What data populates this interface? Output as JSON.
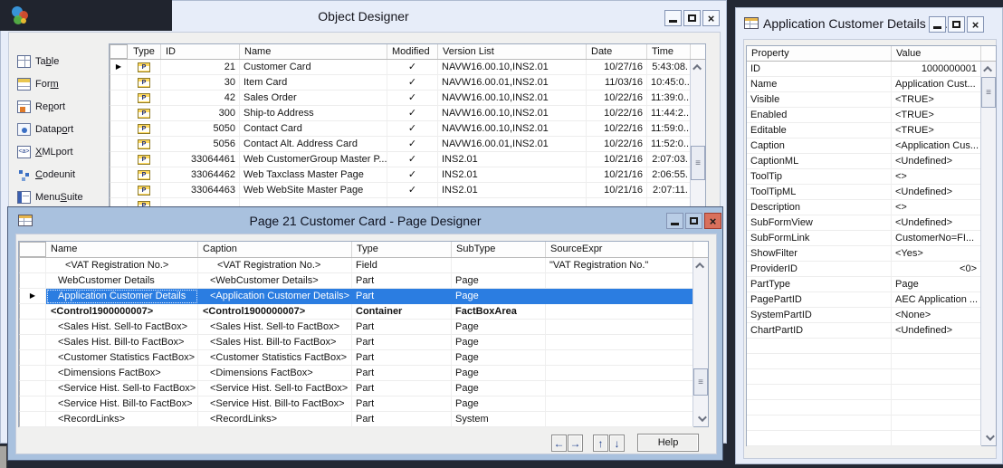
{
  "object_designer": {
    "title": "Object Designer",
    "sidebar": [
      {
        "pre": "Ta",
        "key": "b",
        "post": "le",
        "icon": "table"
      },
      {
        "pre": "For",
        "key": "m",
        "post": "",
        "icon": "form"
      },
      {
        "pre": "Re",
        "key": "p",
        "post": "ort",
        "icon": "report"
      },
      {
        "pre": "Datap",
        "key": "o",
        "post": "rt",
        "icon": "dataport"
      },
      {
        "pre": "",
        "key": "X",
        "post": "MLport",
        "icon": "xmlport"
      },
      {
        "pre": "",
        "key": "C",
        "post": "odeunit",
        "icon": "codeunit"
      },
      {
        "pre": "Menu",
        "key": "S",
        "post": "uite",
        "icon": "menusuite"
      }
    ],
    "columns": {
      "type": "Type",
      "id": "ID",
      "name": "Name",
      "modified": "Modified",
      "version": "Version List",
      "date": "Date",
      "time": "Time"
    },
    "rows": [
      {
        "sel": "▶",
        "id": "21",
        "name": "Customer Card",
        "mod": "✓",
        "version": "NAVW16.00.10,INS2.01",
        "date": "10/27/16",
        "time": "5:43:08."
      },
      {
        "sel": "",
        "id": "30",
        "name": "Item Card",
        "mod": "✓",
        "version": "NAVW16.00.01,INS2.01",
        "date": "11/03/16",
        "time": "10:45:0.."
      },
      {
        "sel": "",
        "id": "42",
        "name": "Sales Order",
        "mod": "✓",
        "version": "NAVW16.00.10,INS2.01",
        "date": "10/22/16",
        "time": "11:39:0.."
      },
      {
        "sel": "",
        "id": "300",
        "name": "Ship-to Address",
        "mod": "✓",
        "version": "NAVW16.00.10,INS2.01",
        "date": "10/22/16",
        "time": "11:44:2.."
      },
      {
        "sel": "",
        "id": "5050",
        "name": "Contact Card",
        "mod": "✓",
        "version": "NAVW16.00.10,INS2.01",
        "date": "10/22/16",
        "time": "11:59:0.."
      },
      {
        "sel": "",
        "id": "5056",
        "name": "Contact Alt. Address Card",
        "mod": "✓",
        "version": "NAVW16.00.01,INS2.01",
        "date": "10/22/16",
        "time": "11:52:0.."
      },
      {
        "sel": "",
        "id": "33064461",
        "name": "Web CustomerGroup Master P...",
        "mod": "✓",
        "version": "INS2.01",
        "date": "10/21/16",
        "time": "2:07:03."
      },
      {
        "sel": "",
        "id": "33064462",
        "name": "Web Taxclass Master Page",
        "mod": "✓",
        "version": "INS2.01",
        "date": "10/21/16",
        "time": "2:06:55."
      },
      {
        "sel": "",
        "id": "33064463",
        "name": "Web WebSite Master Page",
        "mod": "✓",
        "version": "INS2.01",
        "date": "10/21/16",
        "time": "2:07:11."
      },
      {
        "sel": "",
        "id": "",
        "name": "",
        "mod": "",
        "version": "",
        "date": "",
        "time": ""
      }
    ]
  },
  "page_designer": {
    "title": "Page 21 Customer Card - Page Designer",
    "columns": {
      "name": "Name",
      "caption": "Caption",
      "type": "Type",
      "subtype": "SubType",
      "source": "SourceExpr"
    },
    "rows": [
      {
        "sel": "",
        "name": "<VAT Registration No.>",
        "caption": "<VAT Registration No.>",
        "type": "Field",
        "subtype": "",
        "source": "\"VAT Registration No.\"",
        "cls": "ind2"
      },
      {
        "sel": "",
        "name": "WebCustomer Details",
        "caption": "<WebCustomer Details>",
        "type": "Part",
        "subtype": "Page",
        "source": "",
        "cls": "ind1"
      },
      {
        "sel": "▶",
        "name": "Application Customer Details",
        "caption": "<Application Customer Details>",
        "type": "Part",
        "subtype": "Page",
        "source": "",
        "cls": "ind1 sel"
      },
      {
        "sel": "",
        "name": "<Control1900000007>",
        "caption": "<Control1900000007>",
        "type": "Container",
        "subtype": "FactBoxArea",
        "source": "",
        "cls": "ind0 bold"
      },
      {
        "sel": "",
        "name": "<Sales Hist. Sell-to FactBox>",
        "caption": "<Sales Hist. Sell-to FactBox>",
        "type": "Part",
        "subtype": "Page",
        "source": "",
        "cls": "ind1"
      },
      {
        "sel": "",
        "name": "<Sales Hist. Bill-to FactBox>",
        "caption": "<Sales Hist. Bill-to FactBox>",
        "type": "Part",
        "subtype": "Page",
        "source": "",
        "cls": "ind1"
      },
      {
        "sel": "",
        "name": "<Customer Statistics FactBox>",
        "caption": "<Customer Statistics FactBox>",
        "type": "Part",
        "subtype": "Page",
        "source": "",
        "cls": "ind1"
      },
      {
        "sel": "",
        "name": "<Dimensions FactBox>",
        "caption": "<Dimensions FactBox>",
        "type": "Part",
        "subtype": "Page",
        "source": "",
        "cls": "ind1"
      },
      {
        "sel": "",
        "name": "<Service Hist. Sell-to FactBox>",
        "caption": "<Service Hist. Sell-to FactBox>",
        "type": "Part",
        "subtype": "Page",
        "source": "",
        "cls": "ind1"
      },
      {
        "sel": "",
        "name": "<Service Hist. Bill-to FactBox>",
        "caption": "<Service Hist. Bill-to FactBox>",
        "type": "Part",
        "subtype": "Page",
        "source": "",
        "cls": "ind1"
      },
      {
        "sel": "",
        "name": "<RecordLinks>",
        "caption": "<RecordLinks>",
        "type": "Part",
        "subtype": "System",
        "source": "",
        "cls": "ind1"
      }
    ],
    "footer": {
      "left": "←",
      "right": "→",
      "up": "↑",
      "down": "↓",
      "help": "Help"
    }
  },
  "properties_window": {
    "title": "Application Customer Details - ...",
    "columns": {
      "property": "Property",
      "value": "Value"
    },
    "rows": [
      {
        "property": "ID",
        "value": "1000000001",
        "cls": "num"
      },
      {
        "property": "Name",
        "value": "Application Cust..."
      },
      {
        "property": "Visible",
        "value": "<TRUE>"
      },
      {
        "property": "Enabled",
        "value": "<TRUE>"
      },
      {
        "property": "Editable",
        "value": "<TRUE>"
      },
      {
        "property": "Caption",
        "value": "<Application Cus..."
      },
      {
        "property": "CaptionML",
        "value": "<Undefined>"
      },
      {
        "property": "ToolTip",
        "value": "<>"
      },
      {
        "property": "ToolTipML",
        "value": "<Undefined>"
      },
      {
        "property": "Description",
        "value": "<>"
      },
      {
        "property": "SubFormView",
        "value": "<Undefined>"
      },
      {
        "property": "SubFormLink",
        "value": "CustomerNo=FI..."
      },
      {
        "property": "ShowFilter",
        "value": "<Yes>"
      },
      {
        "property": "ProviderID",
        "value": "<0>",
        "cls": "num"
      },
      {
        "property": "PartType",
        "value": "Page"
      },
      {
        "property": "PagePartID",
        "value": "AEC Application ..."
      },
      {
        "property": "SystemPartID",
        "value": "<None>"
      },
      {
        "property": "ChartPartID",
        "value": "<Undefined>"
      },
      {
        "property": "",
        "value": ""
      },
      {
        "property": "",
        "value": ""
      },
      {
        "property": "",
        "value": ""
      },
      {
        "property": "",
        "value": ""
      },
      {
        "property": "",
        "value": ""
      },
      {
        "property": "",
        "value": ""
      },
      {
        "property": "",
        "value": ""
      }
    ]
  },
  "icons": {
    "grip": "≡"
  },
  "colors": {
    "selection": "#2b7de1",
    "titlebar_light": "#e7edf9",
    "titlebar_steel": "#a9c1de",
    "close_red": "#d9705c",
    "desktop": "#232834"
  }
}
